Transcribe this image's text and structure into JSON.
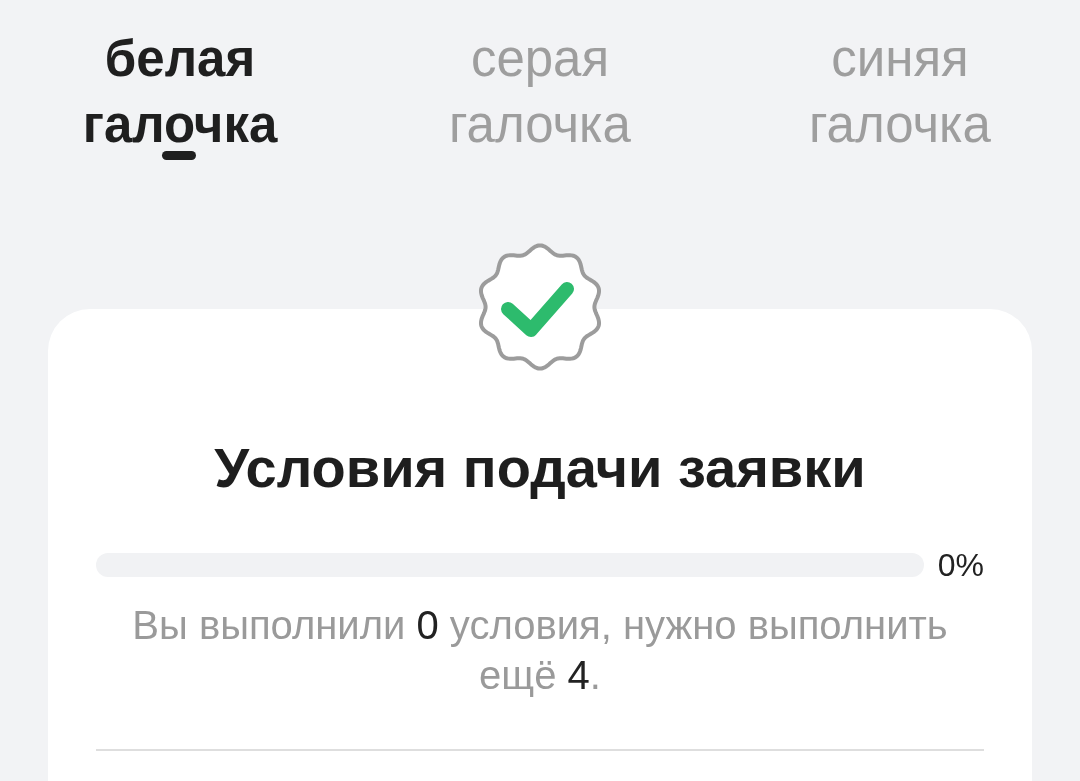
{
  "tabs": [
    {
      "label": "белая галочка",
      "selected": true
    },
    {
      "label": "серая галочка",
      "selected": false
    },
    {
      "label": "синяя галочка",
      "selected": false
    }
  ],
  "card": {
    "title": "Условия подачи заявки",
    "progress": {
      "level": 0,
      "reading": "0%"
    },
    "message": [
      {
        "text": "Вы выполнили ",
        "highlight": false
      },
      {
        "text": "0",
        "highlight": true
      },
      {
        "text": " условия, нужно выполнить ещё ",
        "highlight": false
      },
      {
        "text": "4",
        "highlight": true
      },
      {
        "text": ".",
        "highlight": false
      }
    ]
  }
}
